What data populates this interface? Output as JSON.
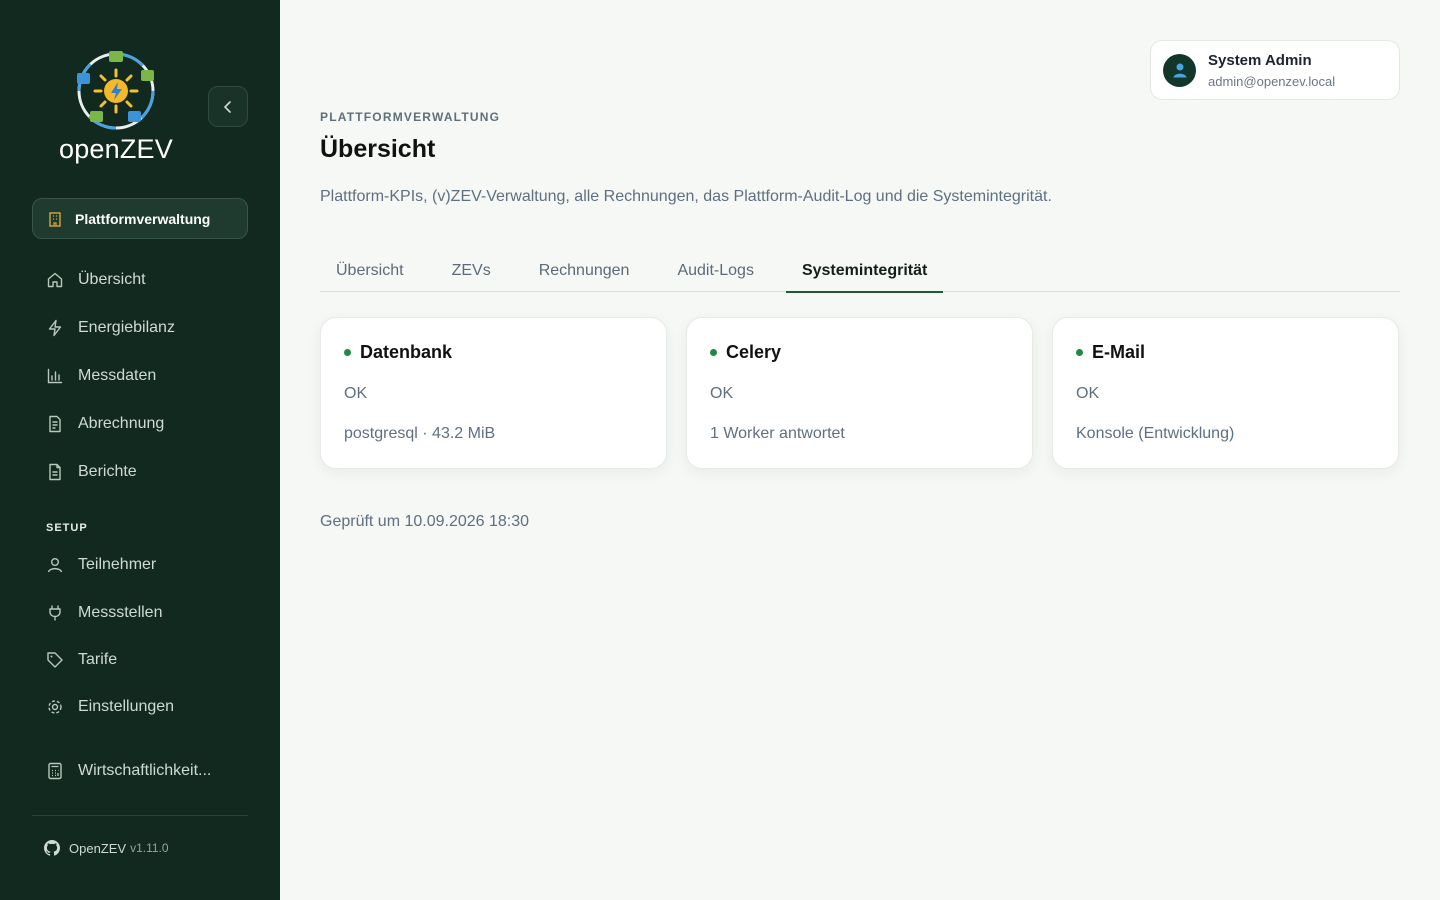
{
  "app": {
    "logo_text": "openZEV"
  },
  "sidebar": {
    "platform_button": "Plattformverwaltung",
    "nav": [
      {
        "label": "Übersicht",
        "icon": "home-icon"
      },
      {
        "label": "Energiebilanz",
        "icon": "bolt-icon"
      },
      {
        "label": "Messdaten",
        "icon": "bar-chart-icon"
      },
      {
        "label": "Abrechnung",
        "icon": "invoice-icon"
      },
      {
        "label": "Berichte",
        "icon": "document-icon"
      }
    ],
    "setup_label": "SETUP",
    "setup": [
      {
        "label": "Teilnehmer",
        "icon": "user-icon"
      },
      {
        "label": "Messstellen",
        "icon": "plug-icon"
      },
      {
        "label": "Tarife",
        "icon": "tag-icon"
      },
      {
        "label": "Einstellungen",
        "icon": "settings-icon"
      }
    ],
    "extra": {
      "label": "Wirtschaftlichkeit...",
      "icon": "calculator-icon"
    },
    "footer": {
      "name": "OpenZEV",
      "version": "v1.11.0"
    }
  },
  "user": {
    "name": "System Admin",
    "email": "admin@openzev.local",
    "icon": "person-icon"
  },
  "page": {
    "eyebrow": "PLATTFORMVERWALTUNG",
    "title": "Übersicht",
    "description": "Plattform-KPIs, (v)ZEV-Verwaltung, alle Rechnungen, das Plattform-Audit-Log und die Systemintegrität."
  },
  "tabs": [
    "Übersicht",
    "ZEVs",
    "Rechnungen",
    "Audit-Logs",
    "Systemintegrität"
  ],
  "active_tab": "Systemintegrität",
  "cards": [
    {
      "title": "Datenbank",
      "status": "OK",
      "detail": "postgresql · 43.2 MiB"
    },
    {
      "title": "Celery",
      "status": "OK",
      "detail": "1 Worker antwortet"
    },
    {
      "title": "E-Mail",
      "status": "OK",
      "detail": "Konsole (Entwicklung)"
    }
  ],
  "checked_at": "Geprüft um 10.09.2026 18:30",
  "colors": {
    "sidebar_bg": "#12291f",
    "accent": "#1f5b3a",
    "status_ok": "#1e8a45"
  }
}
